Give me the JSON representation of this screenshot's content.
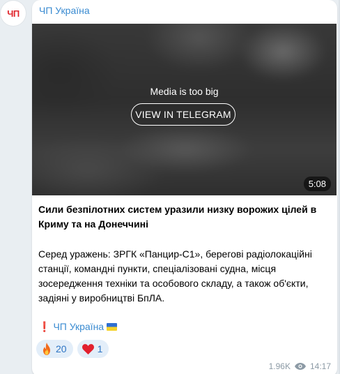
{
  "channel": {
    "avatar_text": "ЧП",
    "name": "ЧП Україна"
  },
  "media": {
    "message": "Media is too big",
    "button_label": "VIEW IN TELEGRAM",
    "duration": "5:08"
  },
  "post": {
    "headline": "Сили безпілотних систем уразили низку ворожих цілей в Криму та на Донеччині",
    "body": "Серед уражень: ЗРГК «Панцир-С1», берегові радіолокаційні станції, командні пункти, спеціалізовані судна, місця зосередження техніки та особового складу, а також об'єкти, задіяні у виробництві БпЛА.",
    "signature_mark": "❗",
    "signature": "ЧП Україна"
  },
  "reactions": [
    {
      "icon": "fire-icon",
      "count": "20"
    },
    {
      "icon": "heart-icon",
      "count": "1"
    }
  ],
  "meta": {
    "views": "1.96K",
    "time": "14:17"
  },
  "colors": {
    "link": "#3a8bd1",
    "reaction_bg": "#e3eef9",
    "background": "#e9eef2"
  }
}
